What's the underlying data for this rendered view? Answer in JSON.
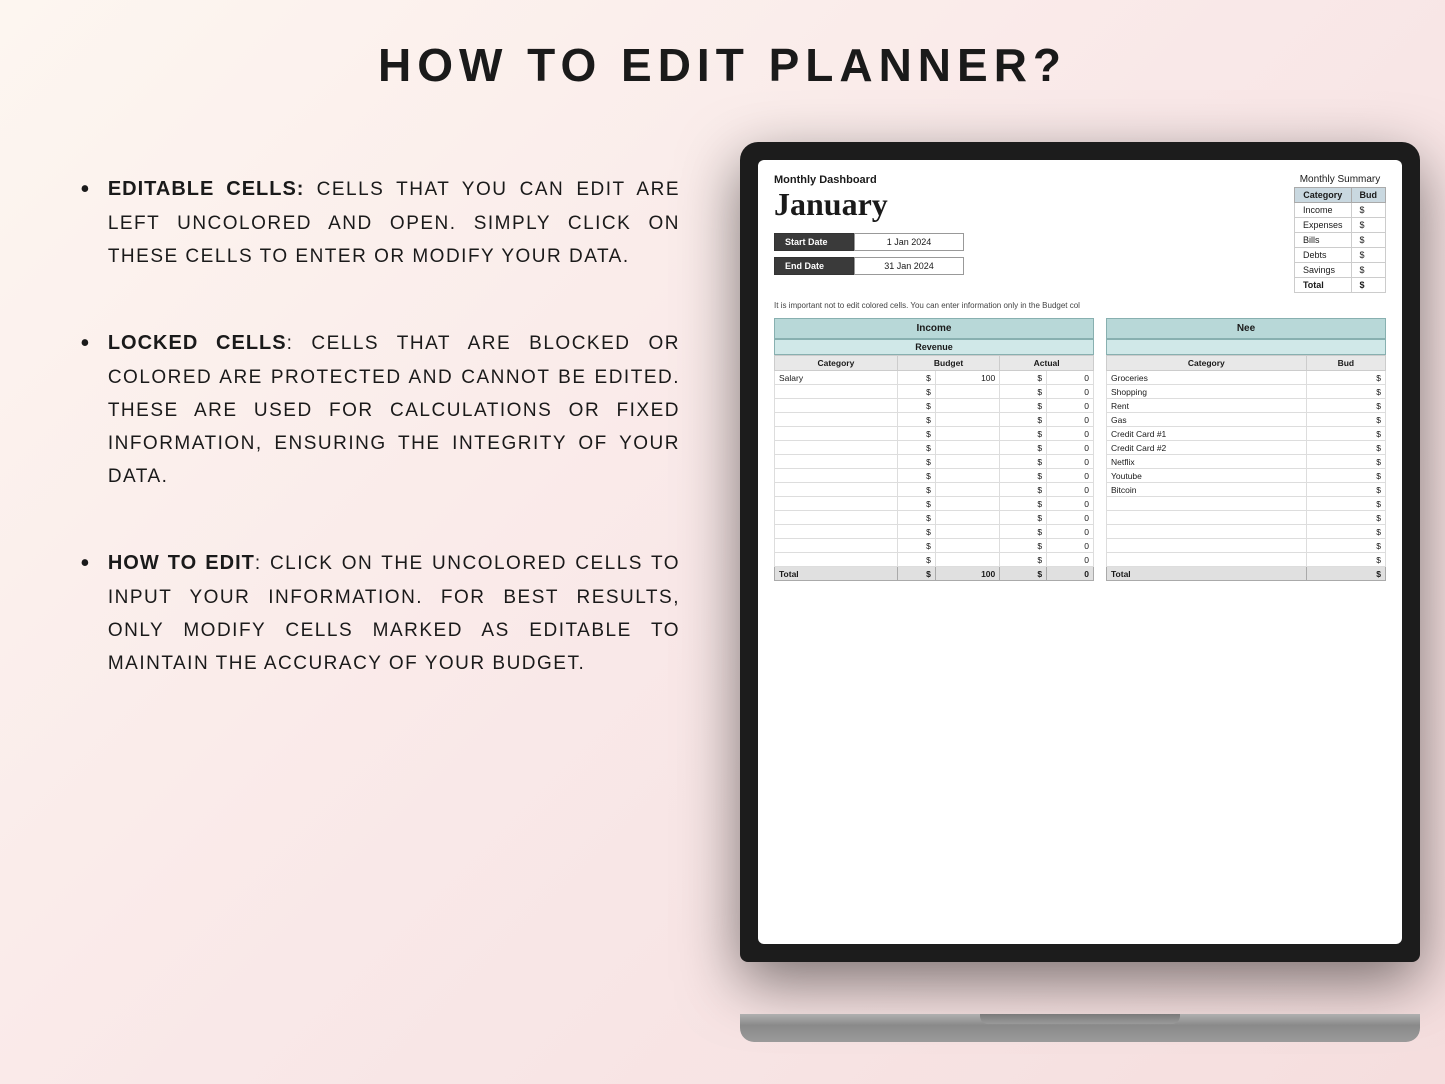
{
  "title": "HOW TO EDIT PLANNER?",
  "bullets": [
    {
      "bold": "Editable Cells:",
      "text": " Cells that you can edit are left uncolored and open. Simply click on these cells to enter or modify your data."
    },
    {
      "bold": "Locked Cells",
      "text": ": Cells that are blocked or colored are protected and cannot be edited. These are used for calculations or fixed information, ensuring the integrity of your data."
    },
    {
      "bold": "How to Edit",
      "text": ": Click on the uncolored cells to input your information. For best results, only modify cells marked as editable to maintain the accuracy of your budget."
    }
  ],
  "spreadsheet": {
    "dashboard_label": "Monthly Dashboard",
    "summary_title": "Monthly Summary",
    "month": "January",
    "start_date_label": "Start Date",
    "start_date": "1 Jan 2024",
    "end_date_label": "End Date",
    "end_date": "31 Jan 2024",
    "note": "It is important not to edit colored cells. You can enter information only in the Budget col",
    "summary_headers": [
      "Category",
      "Bud"
    ],
    "summary_rows": [
      {
        "cat": "Income",
        "val": "$"
      },
      {
        "cat": "Expenses",
        "val": "$"
      },
      {
        "cat": "Bills",
        "val": "$"
      },
      {
        "cat": "Debts",
        "val": "$"
      },
      {
        "cat": "Savings",
        "val": "$"
      },
      {
        "cat": "Total",
        "val": "$",
        "bold": true
      }
    ],
    "income_header": "Income",
    "revenue_sub": "Revenue",
    "income_cols": [
      "Category",
      "Budget",
      "Actual"
    ],
    "income_rows": [
      {
        "cat": "Salary",
        "b": "$ 100",
        "a": "$ 0"
      },
      {
        "cat": "",
        "b": "$",
        "a": "$ 0"
      },
      {
        "cat": "",
        "b": "$",
        "a": "$ 0"
      },
      {
        "cat": "",
        "b": "$",
        "a": "$ 0"
      },
      {
        "cat": "",
        "b": "$",
        "a": "$ 0"
      },
      {
        "cat": "",
        "b": "$",
        "a": "$ 0"
      },
      {
        "cat": "",
        "b": "$",
        "a": "$ 0"
      },
      {
        "cat": "",
        "b": "$",
        "a": "$ 0"
      },
      {
        "cat": "",
        "b": "$",
        "a": "$ 0"
      },
      {
        "cat": "",
        "b": "$",
        "a": "$ 0"
      },
      {
        "cat": "",
        "b": "$",
        "a": "$ 0"
      },
      {
        "cat": "",
        "b": "$",
        "a": "$ 0"
      },
      {
        "cat": "",
        "b": "$",
        "a": "$ 0"
      },
      {
        "cat": "",
        "b": "$",
        "a": "$ 0"
      }
    ],
    "income_total": {
      "cat": "Total",
      "b": "$ 100",
      "a": "$ 0"
    },
    "needs_header": "Nee",
    "needs_cols": [
      "Category",
      "Bud"
    ],
    "needs_rows": [
      {
        "cat": "Groceries",
        "b": "$"
      },
      {
        "cat": "Shopping",
        "b": "$"
      },
      {
        "cat": "Rent",
        "b": "$"
      },
      {
        "cat": "Gas",
        "b": "$"
      },
      {
        "cat": "Credit Card #1",
        "b": "$"
      },
      {
        "cat": "Credit Card #2",
        "b": "$"
      },
      {
        "cat": "Netflix",
        "b": "$"
      },
      {
        "cat": "Youtube",
        "b": "$"
      },
      {
        "cat": "Bitcoin",
        "b": "$"
      },
      {
        "cat": "",
        "b": "$"
      },
      {
        "cat": "",
        "b": "$"
      },
      {
        "cat": "",
        "b": "$"
      },
      {
        "cat": "",
        "b": "$"
      },
      {
        "cat": "",
        "b": "$"
      }
    ],
    "needs_total": {
      "cat": "Total",
      "b": "$"
    }
  },
  "colors": {
    "bg_gradient_start": "#fdf6f0",
    "bg_gradient_end": "#f5dede",
    "section_header_bg": "#b8d8d8",
    "sub_header_bg": "#d0e8e8",
    "summary_header_bg": "#c9d8e0",
    "title_color": "#1a1a1a"
  }
}
